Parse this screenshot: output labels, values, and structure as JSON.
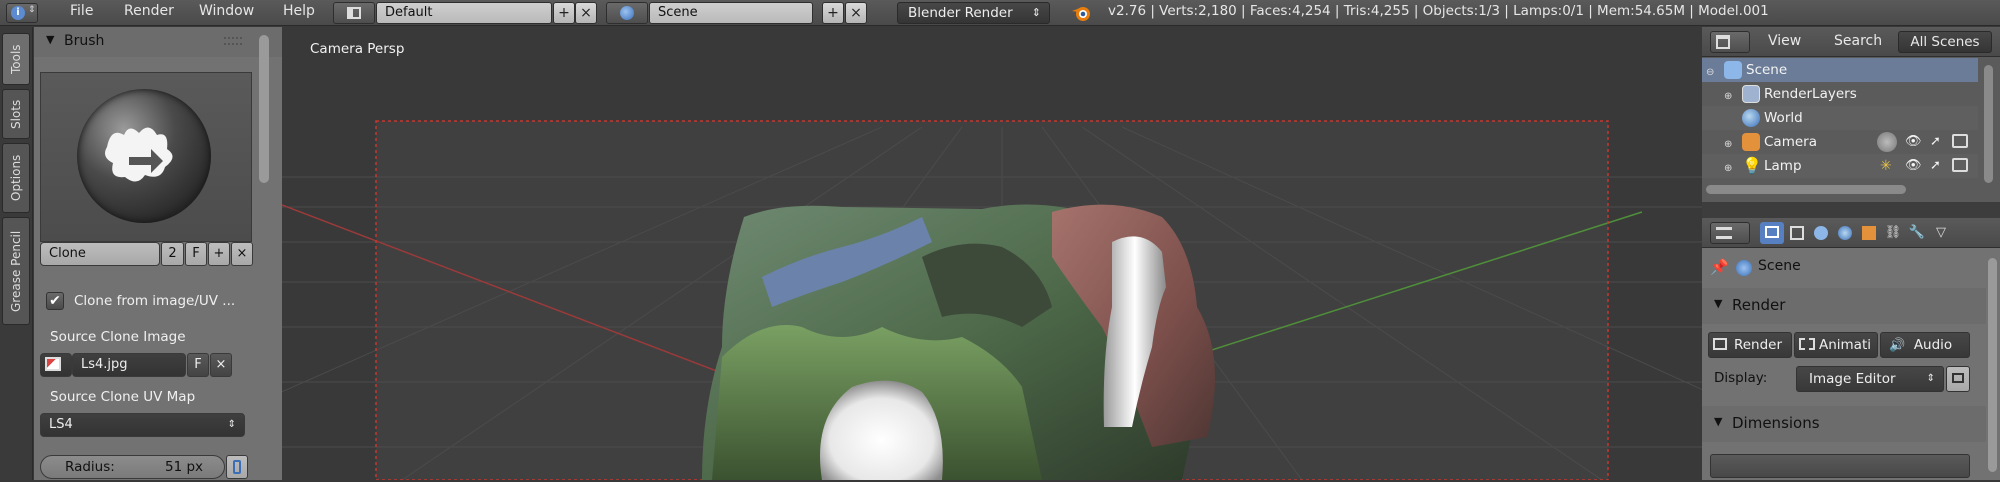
{
  "topbar": {
    "menu": [
      "File",
      "Render",
      "Window",
      "Help"
    ],
    "screen_layout": "Default",
    "scene": "Scene",
    "render_engine": "Blender Render",
    "stats": "v2.76 | Verts:2,180 | Faces:4,254 | Tris:4,255 | Objects:1/3 | Lamps:0/1 | Mem:54.65M | Model.001",
    "add_symbol": "+",
    "close_symbol": "×",
    "engine_arrows": "⇕"
  },
  "side_tabs": [
    "Tools",
    "Slots",
    "Options",
    "Grease Pencil"
  ],
  "tool_panel": {
    "brush_header": "Brush",
    "collapse_arrow": "▼",
    "brush_name": "Clone",
    "brush_users": "2",
    "fake_user": "F",
    "clone_from_label": "Clone from image/UV ...",
    "clone_from_checked": true,
    "source_image_label": "Source Clone Image",
    "source_image": "Ls4.jpg",
    "source_uv_label": "Source Clone UV Map",
    "source_uv": "LS4",
    "radius_label": "Radius:",
    "radius_value": "51 px"
  },
  "viewport": {
    "label": "Camera Persp"
  },
  "outliner": {
    "view_menu": "View",
    "search_menu": "Search",
    "filter": "All Scenes",
    "items": [
      {
        "label": "Scene",
        "indent": 0,
        "icon": "scene-icon",
        "color": "#8db7e8"
      },
      {
        "label": "RenderLayers",
        "indent": 1,
        "icon": "render-layers-icon",
        "color": "#9fb3d1"
      },
      {
        "label": "World",
        "indent": 1,
        "icon": "world-icon",
        "color": "#6ea0d0"
      },
      {
        "label": "Camera",
        "indent": 1,
        "icon": "camera-icon",
        "color": "#e3923b"
      },
      {
        "label": "Lamp",
        "indent": 1,
        "icon": "lamp-icon",
        "color": "#e8c24a"
      }
    ]
  },
  "properties": {
    "context_label": "Scene",
    "render_header": "Render",
    "render_button": "Render",
    "animation_button": "Animati",
    "audio_button": "Audio",
    "display_label": "Display:",
    "display_value": "Image Editor",
    "dimensions_header": "Dimensions"
  },
  "colors": {
    "accent_blue": "#5680c2",
    "panel_gray": "#727272",
    "viewport_bg": "#393939",
    "camera_border": "#c8362f"
  }
}
